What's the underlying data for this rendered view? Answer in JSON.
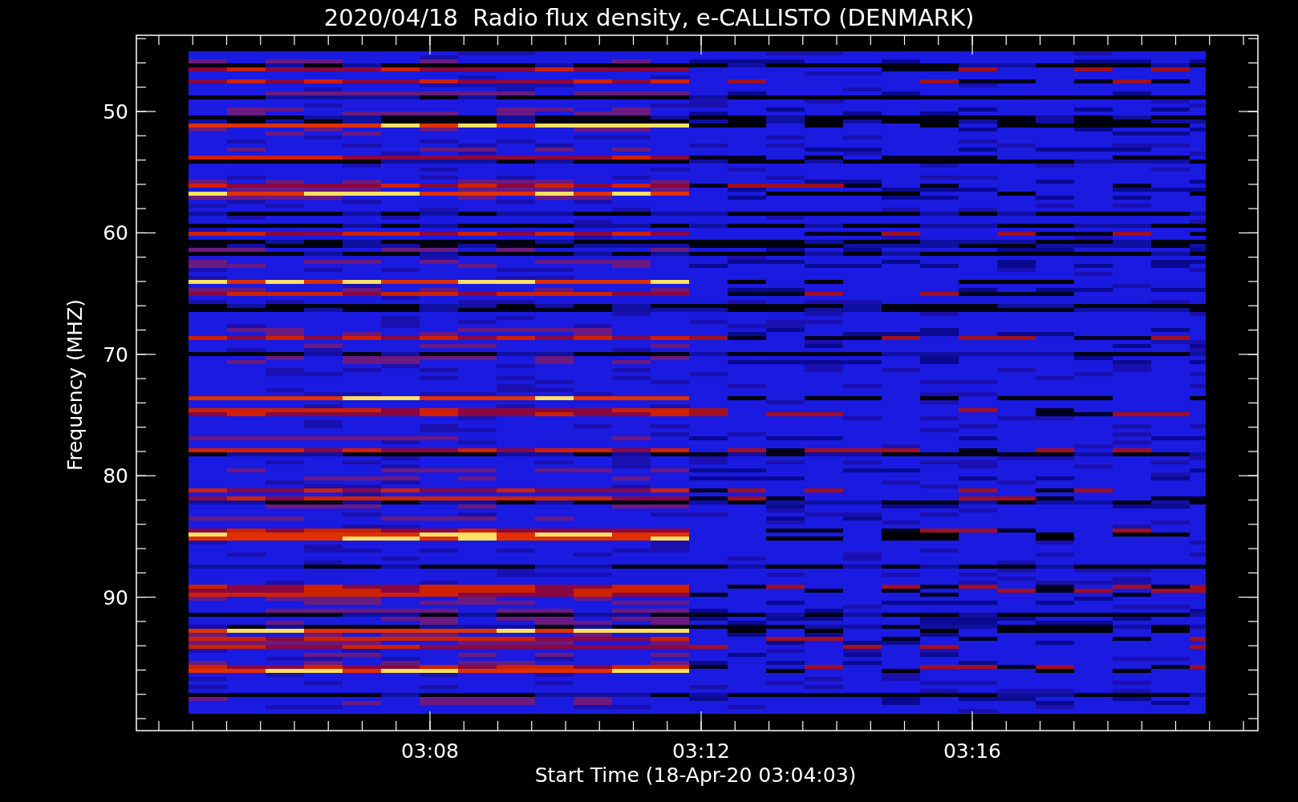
{
  "title": "2020/04/18  Radio flux density, e-CALLISTO (DENMARK)",
  "y_axis": {
    "label": "Frequency (MHZ)",
    "ticks": [
      "50",
      "60",
      "70",
      "80",
      "90"
    ]
  },
  "x_axis": {
    "label": "Start Time (18-Apr-20 03:04:03)",
    "ticks": [
      "03:08",
      "03:12",
      "03:16"
    ]
  }
}
